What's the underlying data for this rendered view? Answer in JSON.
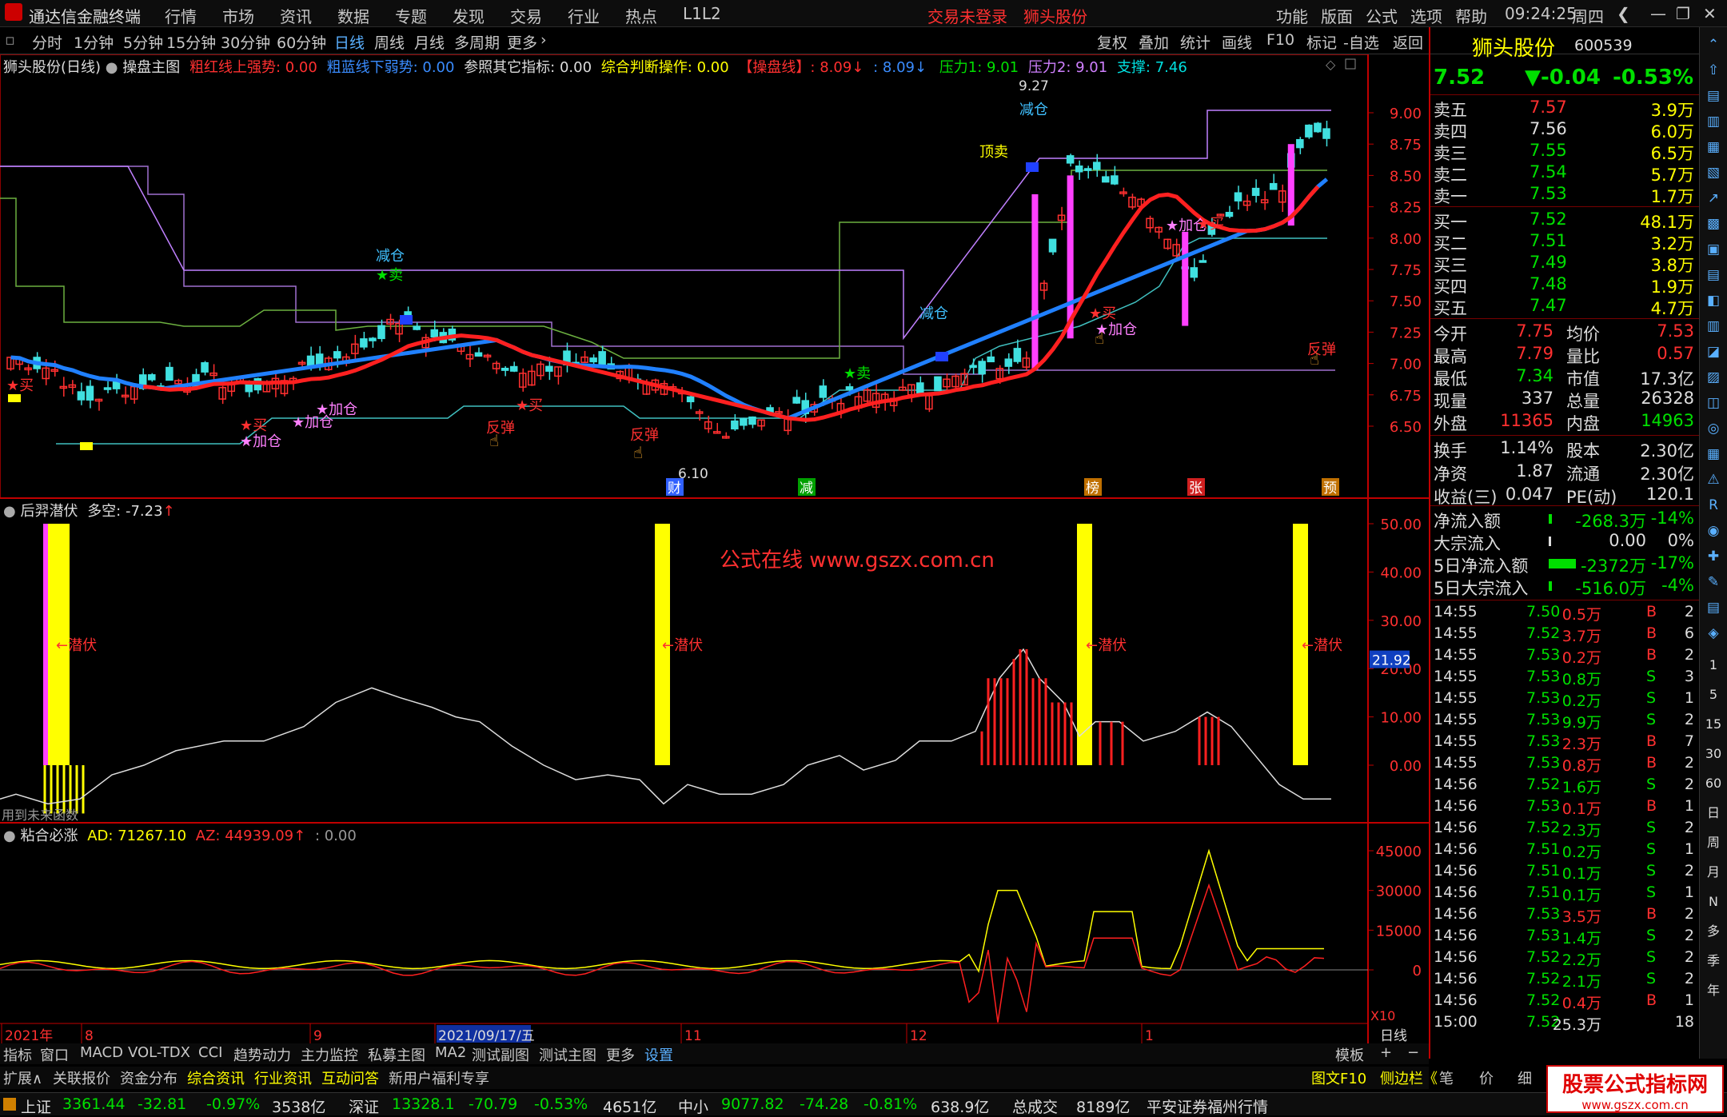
{
  "app": {
    "title": "通达信金融终端",
    "login_status": "交易未登录",
    "stock_name_top": "狮头股份"
  },
  "menu": [
    "行情",
    "市场",
    "资讯",
    "数据",
    "专题",
    "发现",
    "交易",
    "行业",
    "热点",
    "L1L2"
  ],
  "menu_right": [
    "功能",
    "版面",
    "公式",
    "选项",
    "帮助"
  ],
  "clock": "09:24:25",
  "weekday": "周四",
  "periods": [
    "分时",
    "1分钟",
    "5分钟",
    "15分钟",
    "30分钟",
    "60分钟",
    "日线",
    "周线",
    "月线",
    "多周期",
    "更多"
  ],
  "tool_right": [
    "复权",
    "叠加",
    "统计",
    "画线",
    "F10",
    "标记",
    "-自选",
    "返回"
  ],
  "main_title": {
    "name": "狮头股份(日线)",
    "formula": "操盘主图",
    "red_label": "粗红线上强势: 0.00",
    "blue_label": "粗蓝线下弱势: 0.00",
    "ref_label": "参照其它指标: 0.00",
    "judge_label": "综合判断操作: 0.00",
    "op_label": "【操盘线】: 8.09",
    "op_val2": ": 8.09",
    "press1": "压力1: 9.01",
    "press2": "压力2: 9.01",
    "support": "支撑: 7.46"
  },
  "main_axis": [
    "9.00",
    "8.75",
    "8.50",
    "8.25",
    "8.00",
    "7.75",
    "7.50",
    "7.25",
    "7.00",
    "6.75",
    "6.50"
  ],
  "main_annotations": {
    "high": "9.27",
    "low": "6.10",
    "sig_jiancang": "减仓",
    "sig_dingmai": "顶卖",
    "sig_mai": "★卖",
    "sig_buy": "★买",
    "sig_add": "★加仓",
    "sig_fantan": "反弹"
  },
  "date_marks": [
    "财",
    "减",
    "榜",
    "张",
    "预"
  ],
  "ind1": {
    "title": "后羿潜伏",
    "value": "多空: -7.23",
    "axis": [
      "50.00",
      "40.00",
      "30.00",
      "20.00",
      "10.00",
      "0.00"
    ],
    "current": "21.92",
    "label": "潜伏",
    "watermark": "公式在线  www.gszx.com.cn",
    "footnote": "用到未来函数"
  },
  "ind2": {
    "title": "粘合必涨",
    "ad": "AD: 71267.10",
    "az": "AZ: 44939.09",
    "extra": ": 0.00",
    "axis": [
      "45000",
      "30000",
      "15000",
      "0"
    ],
    "scale": "X10"
  },
  "xaxis": {
    "labels": [
      "2021年",
      "8",
      "9",
      "2021/09/17/五",
      "11",
      "12",
      "1"
    ],
    "period": "日线"
  },
  "tabs_row1": [
    "指标",
    "窗口",
    "MACD",
    "VOL-TDX",
    "CCI",
    "趋势动力",
    "主力监控",
    "私募主图",
    "MA2",
    "测试副图",
    "测试主图",
    "更多",
    "设置"
  ],
  "tabs_row1_right": [
    "模板",
    "+",
    "−"
  ],
  "tabs_row2": [
    "扩展∧",
    "关联报价",
    "资金分布",
    "综合资讯",
    "行业资讯",
    "互动问答",
    "新用户福利专享"
  ],
  "tabs_row2_right": [
    "图文F10",
    "侧边栏《",
    "笔",
    "价",
    "细"
  ],
  "quote": {
    "name": "狮头股份",
    "code": "600539",
    "price": "7.52",
    "change": "▼-0.04",
    "pct": "-0.53%",
    "asks": [
      [
        "卖五",
        "7.57",
        "3.9万"
      ],
      [
        "卖四",
        "7.56",
        "6.0万"
      ],
      [
        "卖三",
        "7.55",
        "6.5万"
      ],
      [
        "卖二",
        "7.54",
        "5.7万"
      ],
      [
        "卖一",
        "7.53",
        "1.7万"
      ]
    ],
    "bids": [
      [
        "买一",
        "7.52",
        "48.1万"
      ],
      [
        "买二",
        "7.51",
        "3.2万"
      ],
      [
        "买三",
        "7.49",
        "3.8万"
      ],
      [
        "买四",
        "7.48",
        "1.9万"
      ],
      [
        "买五",
        "7.47",
        "4.7万"
      ]
    ],
    "stats": [
      [
        "今开",
        "7.75",
        "均价",
        "7.53"
      ],
      [
        "最高",
        "7.79",
        "量比",
        "0.57"
      ],
      [
        "最低",
        "7.34",
        "市值",
        "17.3亿"
      ],
      [
        "现量",
        "337",
        "总量",
        "26328"
      ],
      [
        "外盘",
        "11365",
        "内盘",
        "14963"
      ]
    ],
    "stats2": [
      [
        "换手",
        "1.14%",
        "股本",
        "2.30亿"
      ],
      [
        "净资",
        "1.87",
        "流通",
        "2.30亿"
      ],
      [
        "收益(三)",
        "0.047",
        "PE(动)",
        "120.1"
      ]
    ],
    "flows": [
      [
        "净流入额",
        "-268.3万",
        "-14%"
      ],
      [
        "大宗流入",
        "0.00",
        "0%"
      ],
      [
        "5日净流入额",
        "-2372万",
        "-17%"
      ],
      [
        "5日大宗流入",
        "-516.0万",
        "-4%"
      ]
    ],
    "ticks": [
      [
        "14:55",
        "7.50",
        "0.5万",
        "B",
        "2"
      ],
      [
        "14:55",
        "7.52",
        "3.7万",
        "B",
        "6"
      ],
      [
        "14:55",
        "7.53",
        "0.2万",
        "B",
        "2"
      ],
      [
        "14:55",
        "7.53",
        "0.8万",
        "S",
        "3"
      ],
      [
        "14:55",
        "7.53",
        "0.2万",
        "S",
        "1"
      ],
      [
        "14:55",
        "7.53",
        "9.9万",
        "S",
        "2"
      ],
      [
        "14:55",
        "7.53",
        "2.3万",
        "B",
        "7"
      ],
      [
        "14:55",
        "7.53",
        "0.8万",
        "B",
        "2"
      ],
      [
        "14:56",
        "7.52",
        "1.6万",
        "S",
        "2"
      ],
      [
        "14:56",
        "7.53",
        "0.1万",
        "B",
        "1"
      ],
      [
        "14:56",
        "7.52",
        "2.3万",
        "S",
        "2"
      ],
      [
        "14:56",
        "7.51",
        "0.2万",
        "S",
        "1"
      ],
      [
        "14:56",
        "7.51",
        "0.1万",
        "S",
        "2"
      ],
      [
        "14:56",
        "7.51",
        "0.1万",
        "S",
        "1"
      ],
      [
        "14:56",
        "7.53",
        "3.5万",
        "B",
        "2"
      ],
      [
        "14:56",
        "7.53",
        "1.4万",
        "S",
        "2"
      ],
      [
        "14:56",
        "7.52",
        "2.2万",
        "S",
        "2"
      ],
      [
        "14:56",
        "7.52",
        "2.1万",
        "S",
        "2"
      ],
      [
        "14:56",
        "7.52",
        "0.4万",
        "B",
        "1"
      ],
      [
        "15:00",
        "7.52",
        "25.3万",
        "",
        "18"
      ]
    ]
  },
  "sidebar_labels": [
    "1",
    "5",
    "15",
    "30",
    "60",
    "日",
    "周",
    "月",
    "N",
    "多",
    "季",
    "年"
  ],
  "status": {
    "sh": "上证",
    "sh_val": "3361.44",
    "sh_chg": "-32.81",
    "sh_pct": "-0.97%",
    "sh_amt": "3538亿",
    "sz": "深证",
    "sz_val": "13328.1",
    "sz_chg": "-70.79",
    "sz_pct": "-0.53%",
    "sz_amt": "4651亿",
    "zx": "中小",
    "zx_val": "9077.82",
    "zx_chg": "-74.28",
    "zx_pct": "-0.81%",
    "zx_amt": "638.9亿",
    "total": "总成交",
    "total_amt": "8189亿",
    "broker": "平安证券福州行情",
    "logo": "股票公式指标网",
    "logo_url": "www.gszx.com.cn"
  }
}
